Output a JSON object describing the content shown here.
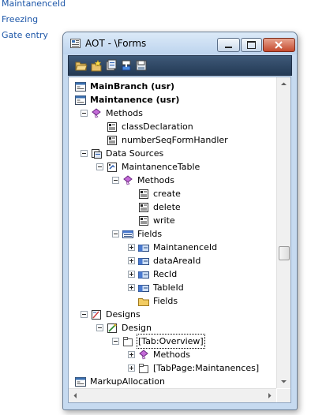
{
  "background_links": [
    "MaintanenceId",
    "Freezing",
    "Gate entry"
  ],
  "window": {
    "title": "AOT - \\Forms",
    "buttons": [
      "minimize",
      "maximize",
      "close"
    ]
  },
  "toolbar": {
    "icons": [
      "open-icon",
      "new-icon",
      "properties-icon",
      "compile-icon",
      "save-icon"
    ]
  },
  "tree": {
    "nodes": [
      {
        "label": "MainBranch (usr)",
        "icon": "form-icon",
        "bold": true,
        "expander": "none"
      },
      {
        "label": "Maintanence (usr)",
        "icon": "form-icon",
        "bold": true,
        "expander": "none"
      },
      {
        "label": "Methods",
        "icon": "methods-icon",
        "expander": "minus"
      },
      {
        "label": "classDeclaration",
        "icon": "method-icon",
        "expander": "none"
      },
      {
        "label": "numberSeqFormHandler",
        "icon": "method-icon",
        "expander": "none"
      },
      {
        "label": "Data Sources",
        "icon": "datasources-icon",
        "expander": "minus"
      },
      {
        "label": "MaintanenceTable",
        "icon": "datasource-icon",
        "expander": "minus"
      },
      {
        "label": "Methods",
        "icon": "methods-icon",
        "expander": "minus"
      },
      {
        "label": "create",
        "icon": "method-icon",
        "expander": "none"
      },
      {
        "label": "delete",
        "icon": "method-icon",
        "expander": "none"
      },
      {
        "label": "write",
        "icon": "method-icon",
        "expander": "none"
      },
      {
        "label": "Fields",
        "icon": "fields-icon",
        "expander": "minus"
      },
      {
        "label": "MaintanenceId",
        "icon": "field-icon",
        "expander": "plus"
      },
      {
        "label": "dataAreaId",
        "icon": "field-icon",
        "expander": "plus"
      },
      {
        "label": "RecId",
        "icon": "field-icon",
        "expander": "plus"
      },
      {
        "label": "TableId",
        "icon": "field-icon",
        "expander": "plus"
      },
      {
        "label": "Fields",
        "icon": "folder-icon",
        "expander": "none"
      },
      {
        "label": "Designs",
        "icon": "designs-icon",
        "expander": "minus"
      },
      {
        "label": "Design",
        "icon": "design-icon",
        "expander": "minus"
      },
      {
        "label": "[Tab:Overview]",
        "icon": "tab-icon",
        "expander": "minus",
        "selected": true
      },
      {
        "label": "Methods",
        "icon": "methods-icon",
        "expander": "plus"
      },
      {
        "label": "[TabPage:Maintanences]",
        "icon": "tab-icon",
        "expander": "plus"
      },
      {
        "label": "MarkupAllocation",
        "icon": "form-icon",
        "expander": "none"
      }
    ]
  },
  "colors": {
    "link": "#1c56a8",
    "window_frame": "#c6daf0",
    "toolbar": "#2e4766"
  }
}
